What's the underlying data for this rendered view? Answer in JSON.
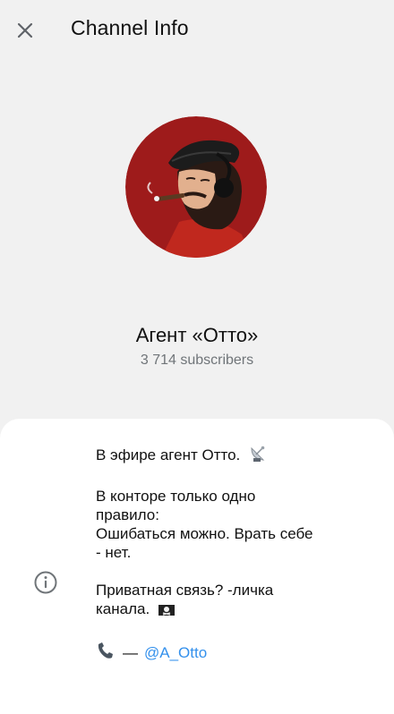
{
  "header": {
    "title": "Channel Info"
  },
  "channel": {
    "name": "Агент «Отто»",
    "subscribers": "3 714 subscribers"
  },
  "description": {
    "line1": "В эфире агент Отто.",
    "line2": "В конторе только одно",
    "line3": "правило:",
    "line4": "Ошибаться можно. Врать себе",
    "line5": "- нет.",
    "line6": "Приватная связь? -личка",
    "line7": "канала.",
    "contact_dash": "—",
    "contact_link": "@A_Otto"
  },
  "icons": {
    "close": "close-icon",
    "info": "info-icon",
    "satellite": "satellite-dish-emoji",
    "pirate_flag": "pirate-flag-emoji",
    "phone": "telephone-receiver-emoji"
  },
  "colors": {
    "background": "#f1f1f1",
    "card": "#ffffff",
    "link": "#3390ec",
    "secondary_text": "#707579",
    "avatar_bg": "#9e1b1b"
  }
}
